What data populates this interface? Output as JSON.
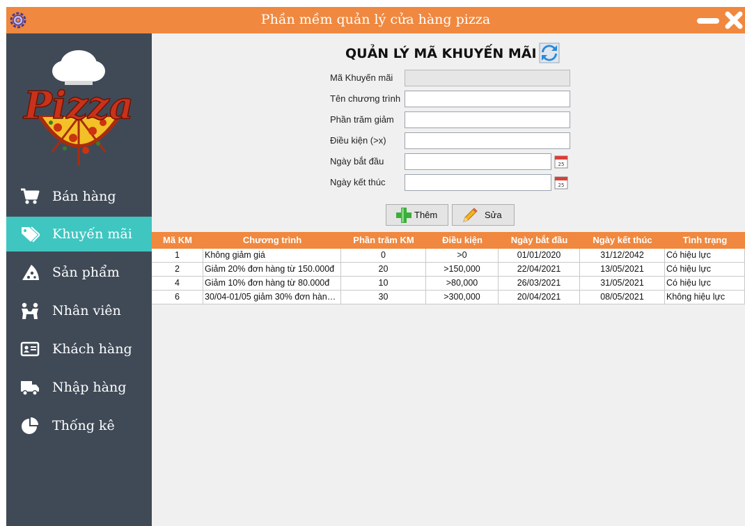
{
  "window": {
    "title": "Phần mềm quản lý cửa hàng pizza"
  },
  "brand": {
    "logo_text": "Pizza"
  },
  "colors": {
    "accent": "#f0883f",
    "sidebar": "#404a57",
    "active": "#3fc6c1"
  },
  "sidebar": {
    "items": [
      {
        "label": "Bán hàng",
        "icon": "cart-icon",
        "active": false
      },
      {
        "label": "Khuyến mãi",
        "icon": "tag-icon",
        "active": true
      },
      {
        "label": "Sản phẩm",
        "icon": "pizza-slice-icon",
        "active": false
      },
      {
        "label": "Nhân viên",
        "icon": "people-icon",
        "active": false
      },
      {
        "label": "Khách hàng",
        "icon": "id-card-icon",
        "active": false
      },
      {
        "label": "Nhập hàng",
        "icon": "truck-icon",
        "active": false
      },
      {
        "label": "Thống kê",
        "icon": "pie-chart-icon",
        "active": false
      }
    ]
  },
  "page": {
    "title": "QUẢN LÝ MÃ KHUYẾN MÃI"
  },
  "form": {
    "fields": [
      {
        "label": "Mã Khuyến mãi",
        "value": ""
      },
      {
        "label": "Tên chương trình",
        "value": ""
      },
      {
        "label": "Phần trăm giảm",
        "value": ""
      },
      {
        "label": "Điều kiện (>x)",
        "value": ""
      },
      {
        "label": "Ngày bắt đầu",
        "value": ""
      },
      {
        "label": "Ngày kết thúc",
        "value": ""
      }
    ],
    "calendar_day": "25"
  },
  "buttons": {
    "add": "Thêm",
    "edit": "Sửa"
  },
  "table": {
    "headers": [
      "Mã KM",
      "Chương trình",
      "Phần trăm KM",
      "Điều kiện",
      "Ngày bắt đầu",
      "Ngày kết thúc",
      "Tình trạng"
    ],
    "rows": [
      [
        "1",
        "Không giảm giá",
        "0",
        ">0",
        "01/01/2020",
        "31/12/2042",
        "Có hiệu lực"
      ],
      [
        "2",
        "Giảm 20% đơn hàng từ 150.000đ",
        "20",
        ">150,000",
        "22/04/2021",
        "13/05/2021",
        "Có hiệu lực"
      ],
      [
        "4",
        "Giảm 10% đơn hàng từ 80.000đ",
        "10",
        ">80,000",
        "26/03/2021",
        "31/05/2021",
        "Có hiệu lực"
      ],
      [
        "6",
        "30/04-01/05 giảm 30% đơn hàng t...",
        "30",
        ">300,000",
        "20/04/2021",
        "08/05/2021",
        "Không hiệu lực"
      ]
    ]
  }
}
